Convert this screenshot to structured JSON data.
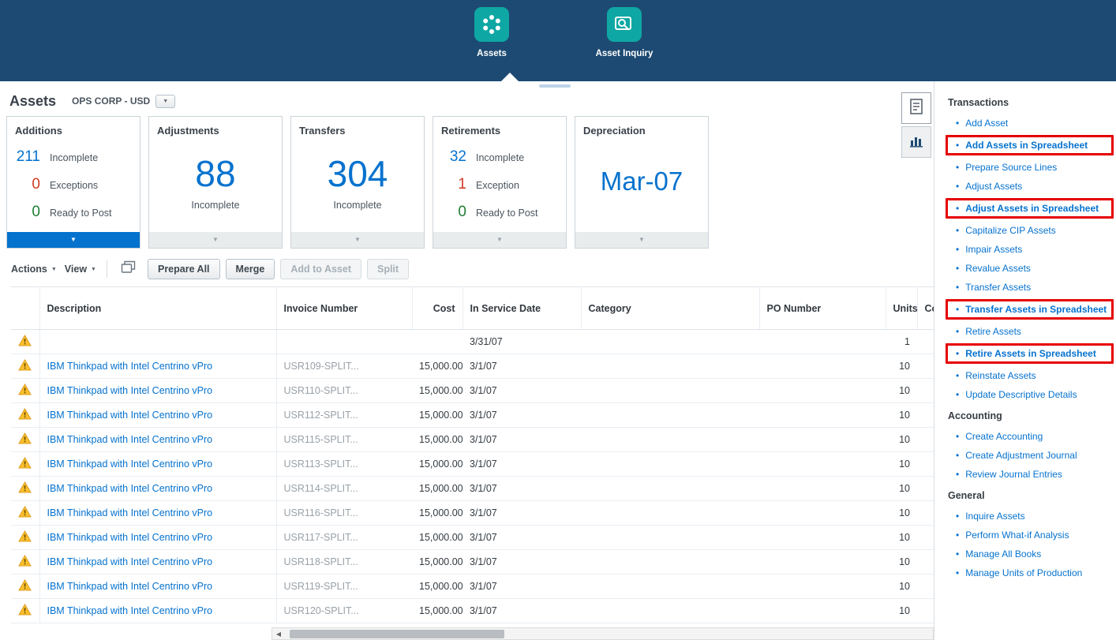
{
  "ui_colors": {
    "banner_navy": "#1d4a72",
    "icon_teal": "#0fa7a4",
    "accent_blue": "#0572ce",
    "error_red": "#d13a27",
    "success_green": "#1e7e34",
    "highlight_box_red": "#e60000"
  },
  "banner": {
    "items": [
      {
        "label": "Assets",
        "icon": "assets-grid-icon",
        "active": true
      },
      {
        "label": "Asset Inquiry",
        "icon": "asset-inquiry-icon",
        "active": false
      }
    ]
  },
  "page": {
    "title": "Assets",
    "book_selector": "OPS CORP - USD"
  },
  "infotiles": [
    {
      "title": "Additions",
      "type": "rows",
      "selected": true,
      "rows": [
        {
          "value": "211",
          "label": "Incomplete",
          "color": "#0572ce"
        },
        {
          "value": "0",
          "label": "Exceptions",
          "color": "#d13a27"
        },
        {
          "value": "0",
          "label": "Ready to Post",
          "color": "#1e7e34"
        }
      ]
    },
    {
      "title": "Adjustments",
      "type": "big",
      "big_value": "88",
      "big_label": "Incomplete"
    },
    {
      "title": "Transfers",
      "type": "big",
      "big_value": "304",
      "big_label": "Incomplete"
    },
    {
      "title": "Retirements",
      "type": "rows",
      "selected": false,
      "rows": [
        {
          "value": "32",
          "label": "Incomplete",
          "color": "#0572ce"
        },
        {
          "value": "1",
          "label": "Exception",
          "color": "#d13a27"
        },
        {
          "value": "0",
          "label": "Ready to Post",
          "color": "#1e7e34"
        }
      ]
    },
    {
      "title": "Depreciation",
      "type": "big",
      "big_value": "Mar-07",
      "big_label": ""
    }
  ],
  "toolbar": {
    "actions_label": "Actions",
    "view_label": "View",
    "buttons": [
      {
        "label": "Prepare All",
        "enabled": true
      },
      {
        "label": "Merge",
        "enabled": true
      },
      {
        "label": "Add to Asset",
        "enabled": false
      },
      {
        "label": "Split",
        "enabled": false
      }
    ]
  },
  "table": {
    "columns": [
      {
        "label": "Description",
        "key": "description",
        "cls": "c-desc"
      },
      {
        "label": "Invoice Number",
        "key": "invoice",
        "cls": "c-inv"
      },
      {
        "label": "Cost",
        "key": "cost",
        "cls": "c-cost",
        "align": "right"
      },
      {
        "label": "In Service Date",
        "key": "date",
        "cls": "c-date"
      },
      {
        "label": "Category",
        "key": "category",
        "cls": "c-cat"
      },
      {
        "label": "PO Number",
        "key": "po",
        "cls": "c-po"
      },
      {
        "label": "Units",
        "key": "units",
        "cls": "c-units",
        "align": "right"
      },
      {
        "label": "Comments",
        "key": "comments",
        "cls": "c-com"
      }
    ],
    "rows": [
      {
        "warning": true,
        "description": "",
        "invoice": "",
        "cost": "",
        "date": "3/31/07",
        "category": "",
        "po": "",
        "units": "1",
        "comments": ""
      },
      {
        "warning": true,
        "description": "IBM Thinkpad with Intel Centrino vPro",
        "invoice": "USR109-SPLIT...",
        "cost": "15,000.00",
        "date": "3/1/07",
        "category": "",
        "po": "",
        "units": "10",
        "comments": ""
      },
      {
        "warning": true,
        "description": "IBM Thinkpad with Intel Centrino vPro",
        "invoice": "USR110-SPLIT...",
        "cost": "15,000.00",
        "date": "3/1/07",
        "category": "",
        "po": "",
        "units": "10",
        "comments": ""
      },
      {
        "warning": true,
        "description": "IBM Thinkpad with Intel Centrino vPro",
        "invoice": "USR112-SPLIT...",
        "cost": "15,000.00",
        "date": "3/1/07",
        "category": "",
        "po": "",
        "units": "10",
        "comments": ""
      },
      {
        "warning": true,
        "description": "IBM Thinkpad with Intel Centrino vPro",
        "invoice": "USR115-SPLIT...",
        "cost": "15,000.00",
        "date": "3/1/07",
        "category": "",
        "po": "",
        "units": "10",
        "comments": ""
      },
      {
        "warning": true,
        "description": "IBM Thinkpad with Intel Centrino vPro",
        "invoice": "USR113-SPLIT...",
        "cost": "15,000.00",
        "date": "3/1/07",
        "category": "",
        "po": "",
        "units": "10",
        "comments": ""
      },
      {
        "warning": true,
        "description": "IBM Thinkpad with Intel Centrino vPro",
        "invoice": "USR114-SPLIT...",
        "cost": "15,000.00",
        "date": "3/1/07",
        "category": "",
        "po": "",
        "units": "10",
        "comments": ""
      },
      {
        "warning": true,
        "description": "IBM Thinkpad with Intel Centrino vPro",
        "invoice": "USR116-SPLIT...",
        "cost": "15,000.00",
        "date": "3/1/07",
        "category": "",
        "po": "",
        "units": "10",
        "comments": ""
      },
      {
        "warning": true,
        "description": "IBM Thinkpad with Intel Centrino vPro",
        "invoice": "USR117-SPLIT...",
        "cost": "15,000.00",
        "date": "3/1/07",
        "category": "",
        "po": "",
        "units": "10",
        "comments": ""
      },
      {
        "warning": true,
        "description": "IBM Thinkpad with Intel Centrino vPro",
        "invoice": "USR118-SPLIT...",
        "cost": "15,000.00",
        "date": "3/1/07",
        "category": "",
        "po": "",
        "units": "10",
        "comments": ""
      },
      {
        "warning": true,
        "description": "IBM Thinkpad with Intel Centrino vPro",
        "invoice": "USR119-SPLIT...",
        "cost": "15,000.00",
        "date": "3/1/07",
        "category": "",
        "po": "",
        "units": "10",
        "comments": ""
      },
      {
        "warning": true,
        "description": "IBM Thinkpad with Intel Centrino vPro",
        "invoice": "USR120-SPLIT...",
        "cost": "15,000.00",
        "date": "3/1/07",
        "category": "",
        "po": "",
        "units": "10",
        "comments": ""
      }
    ]
  },
  "task_panel": {
    "sections": [
      {
        "title": "Transactions",
        "items": [
          {
            "label": "Add Asset",
            "highlighted": false
          },
          {
            "label": "Add Assets in Spreadsheet",
            "highlighted": true
          },
          {
            "label": "Prepare Source Lines",
            "highlighted": false
          },
          {
            "label": "Adjust Assets",
            "highlighted": false
          },
          {
            "label": "Adjust Assets in Spreadsheet",
            "highlighted": true
          },
          {
            "label": "Capitalize CIP Assets",
            "highlighted": false
          },
          {
            "label": "Impair Assets",
            "highlighted": false
          },
          {
            "label": "Revalue Assets",
            "highlighted": false
          },
          {
            "label": "Transfer Assets",
            "highlighted": false
          },
          {
            "label": "Transfer Assets in Spreadsheet",
            "highlighted": true
          },
          {
            "label": "Retire Assets",
            "highlighted": false
          },
          {
            "label": "Retire Assets in Spreadsheet",
            "highlighted": true
          },
          {
            "label": "Reinstate Assets",
            "highlighted": false
          },
          {
            "label": "Update Descriptive Details",
            "highlighted": false
          }
        ]
      },
      {
        "title": "Accounting",
        "items": [
          {
            "label": "Create Accounting",
            "highlighted": false
          },
          {
            "label": "Create Adjustment Journal",
            "highlighted": false
          },
          {
            "label": "Review Journal Entries",
            "highlighted": false
          }
        ]
      },
      {
        "title": "General",
        "items": [
          {
            "label": "Inquire Assets",
            "highlighted": false
          },
          {
            "label": "Perform What-if Analysis",
            "highlighted": false
          },
          {
            "label": "Manage All Books",
            "highlighted": false
          },
          {
            "label": "Manage Units of Production",
            "highlighted": false
          }
        ]
      }
    ]
  }
}
